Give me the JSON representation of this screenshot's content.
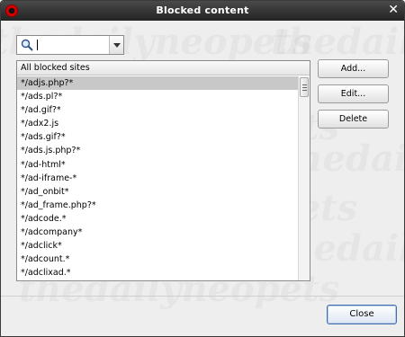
{
  "window": {
    "title": "Blocked content"
  },
  "search": {
    "value": ""
  },
  "list": {
    "header": "All blocked sites",
    "items": [
      "*/adjs.php?*",
      "*/ads.pl?*",
      "*/ad.gif?*",
      "*/adx2.js",
      "*/ads.gif?*",
      "*/ads.js.php?*",
      "*/ad-html*",
      "*/ad-iframe-*",
      "*/ad_onbit*",
      "*/ad_frame.php?*",
      "*/adcode.*",
      "*/adcompany*",
      "*/adclick*",
      "*/adcount.*",
      "*/adclixad.*"
    ],
    "selected_index": 0
  },
  "buttons": {
    "add": "Add...",
    "edit": "Edit...",
    "delete": "Delete",
    "close": "Close"
  },
  "watermark": {
    "text": "thedailyneopets"
  }
}
